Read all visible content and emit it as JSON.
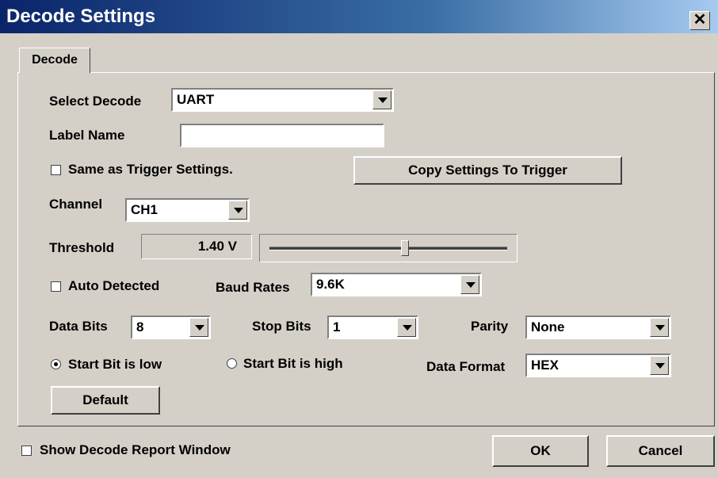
{
  "window": {
    "title": "Decode Settings",
    "close_glyph": "✕"
  },
  "tabs": [
    {
      "label": "Decode",
      "selected": true
    }
  ],
  "form": {
    "select_decode": {
      "label": "Select Decode",
      "value": "UART"
    },
    "label_name": {
      "label": "Label Name",
      "value": ""
    },
    "same_as_trigger": {
      "label": "Same as Trigger Settings.",
      "checked": false
    },
    "copy_settings_button": "Copy Settings To Trigger",
    "channel": {
      "label": "Channel",
      "value": "CH1"
    },
    "threshold": {
      "label": "Threshold",
      "value": "1.40 V",
      "slider_level": 0.57
    },
    "auto_detected": {
      "label": "Auto Detected",
      "checked": false
    },
    "baud_rates": {
      "label": "Baud Rates",
      "value": "9.6K"
    },
    "data_bits": {
      "label": "Data Bits",
      "value": "8"
    },
    "stop_bits": {
      "label": "Stop Bits",
      "value": "1"
    },
    "parity": {
      "label": "Parity",
      "value": "None"
    },
    "start_bit_low": {
      "label": "Start Bit is low",
      "selected": true
    },
    "start_bit_high": {
      "label": "Start Bit is high",
      "selected": false
    },
    "data_format": {
      "label": "Data Format",
      "value": "HEX"
    },
    "default_button": "Default"
  },
  "footer": {
    "show_report": {
      "label": "Show Decode Report Window",
      "checked": false
    },
    "ok_button": "OK",
    "cancel_button": "Cancel"
  },
  "colors": {
    "titlebar_start": "#0a246a",
    "titlebar_end": "#a6caf0",
    "face": "#d4d0c8"
  }
}
